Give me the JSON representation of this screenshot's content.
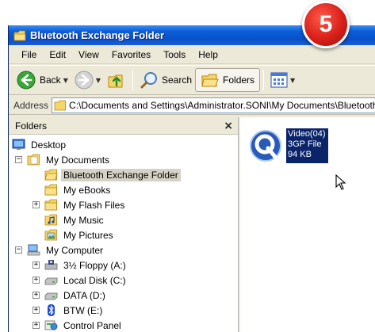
{
  "step_badge": "5",
  "window": {
    "title": "Bluetooth Exchange Folder"
  },
  "menu": [
    "File",
    "Edit",
    "View",
    "Favorites",
    "Tools",
    "Help"
  ],
  "toolbar": {
    "back_label": "Back",
    "search_label": "Search",
    "folders_label": "Folders"
  },
  "address": {
    "label": "Address",
    "value": "C:\\Documents and Settings\\Administrator.SONI\\My Documents\\Bluetooth"
  },
  "folders_pane": {
    "title": "Folders",
    "close": "×",
    "tree": [
      {
        "label": "Desktop"
      },
      {
        "label": "My Documents",
        "expander": "−"
      },
      {
        "label": "Bluetooth Exchange Folder",
        "selected": true
      },
      {
        "label": "My eBooks"
      },
      {
        "label": "My Flash Files",
        "expander": "+"
      },
      {
        "label": "My Music"
      },
      {
        "label": "My Pictures"
      },
      {
        "label": "My Computer",
        "expander": "−"
      },
      {
        "label": "3½ Floppy (A:)",
        "expander": "+"
      },
      {
        "label": "Local Disk (C:)",
        "expander": "+"
      },
      {
        "label": "DATA (D:)",
        "expander": "+"
      },
      {
        "label": "BTW (E:)",
        "expander": "+"
      },
      {
        "label": "Control Panel",
        "expander": "+"
      }
    ]
  },
  "file": {
    "name": "Video(04)",
    "type": "3GP File",
    "size": "94 KB",
    "icon": "quicktime-icon"
  },
  "colors": {
    "title_bar": "#0a5fd8",
    "selection": "#0a246a",
    "badge": "#d8201a"
  }
}
